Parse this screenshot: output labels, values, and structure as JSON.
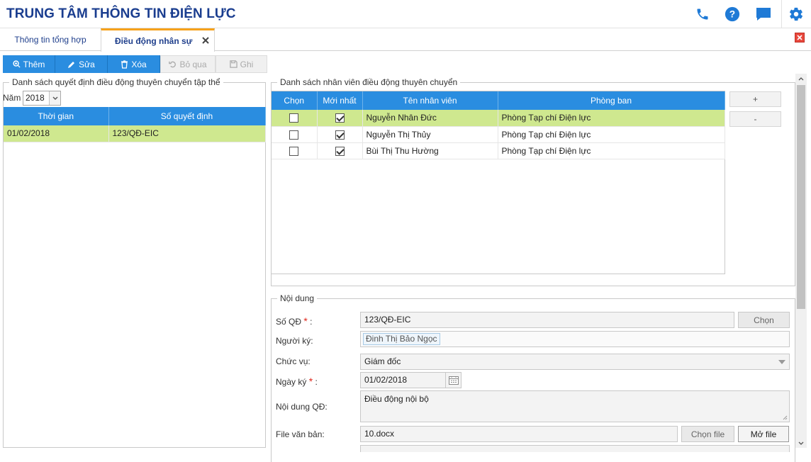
{
  "header": {
    "title": "TRUNG TÂM THÔNG TIN ĐIỆN LỰC",
    "icons": [
      "phone-icon",
      "help-icon",
      "chat-icon",
      "gear-icon"
    ],
    "brand_color": "#1a3d8f",
    "accent_color": "#2a8de0"
  },
  "tabs": [
    {
      "label": "Thông tin tổng hợp",
      "active": false
    },
    {
      "label": "Điều động nhân sự",
      "active": true
    }
  ],
  "toolbar": {
    "add_label": "Thêm",
    "edit_label": "Sửa",
    "delete_label": "Xóa",
    "skip_label": "Bỏ qua",
    "save_label": "Ghi"
  },
  "left_panel": {
    "legend": "Danh sách quyết định điều động thuyên chuyển tập thể",
    "year_label": "Năm",
    "year_value": "2018",
    "columns": [
      "Thời gian",
      "Số quyết định"
    ],
    "rows": [
      {
        "date": "01/02/2018",
        "number": "123/QĐ-EIC",
        "selected": true
      }
    ]
  },
  "staff_panel": {
    "legend": "Danh sách nhân viên điều động thuyên chuyển",
    "columns": [
      "Chọn",
      "Mới nhất",
      "Tên nhân viên",
      "Phòng ban"
    ],
    "rows": [
      {
        "chon": false,
        "moi_nhat": true,
        "name": "Nguyễn Nhân Đức",
        "department": "Phòng Tạp chí Điện lực",
        "selected": true
      },
      {
        "chon": false,
        "moi_nhat": true,
        "name": "Nguyễn Thị Thủy",
        "department": "Phòng Tạp chí Điện lực",
        "selected": false
      },
      {
        "chon": false,
        "moi_nhat": true,
        "name": "Bùi Thị Thu Hường",
        "department": "Phòng Tạp chí Điện lực",
        "selected": false
      }
    ],
    "add_label": "+",
    "remove_label": "-"
  },
  "form": {
    "legend": "Nội dung",
    "so_qd_label": "Số QĐ",
    "so_qd_value": "123/QĐ-EIC",
    "chon_label": "Chọn",
    "nguoi_ky_label": "Người ký:",
    "nguoi_ky_value": "Đinh Thị Bảo Ngọc",
    "chuc_vu_label": "Chức vụ:",
    "chuc_vu_value": "Giám đốc",
    "ngay_ky_label": "Ngày ký",
    "ngay_ky_value": "01/02/2018",
    "noi_dung_label": "Nội dung QĐ:",
    "noi_dung_value": "Điều động nội bộ",
    "file_label": "File văn bản:",
    "file_value": "10.docx",
    "choose_file_label": "Chọn file",
    "open_file_label": "Mở file"
  }
}
